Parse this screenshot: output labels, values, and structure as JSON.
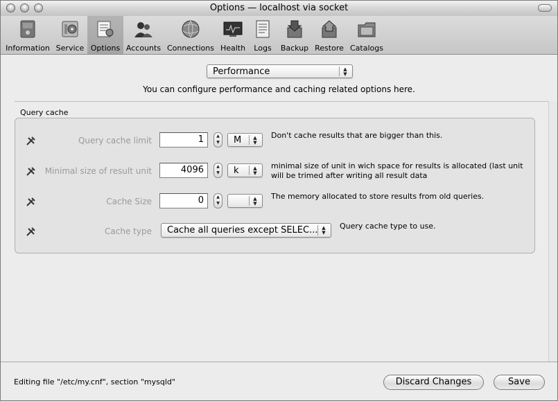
{
  "window": {
    "title": "Options — localhost via socket"
  },
  "toolbar": {
    "items": [
      {
        "label": "Information",
        "icon": "information-icon"
      },
      {
        "label": "Service",
        "icon": "service-icon"
      },
      {
        "label": "Options",
        "icon": "options-icon",
        "selected": true
      },
      {
        "label": "Accounts",
        "icon": "accounts-icon"
      },
      {
        "label": "Connections",
        "icon": "connections-icon"
      },
      {
        "label": "Health",
        "icon": "health-icon"
      },
      {
        "label": "Logs",
        "icon": "logs-icon"
      },
      {
        "label": "Backup",
        "icon": "backup-icon"
      },
      {
        "label": "Restore",
        "icon": "restore-icon"
      },
      {
        "label": "Catalogs",
        "icon": "catalogs-icon"
      }
    ]
  },
  "section_select": {
    "value": "Performance"
  },
  "section_description": "You can configure performance and caching related options here.",
  "group": {
    "title": "Query cache",
    "rows": [
      {
        "label": "Query cache limit",
        "value": "1",
        "unit": "M",
        "description": "Don't cache results that are bigger than this."
      },
      {
        "label": "Minimal size of result unit",
        "value": "4096",
        "unit": "k",
        "description": "minimal size of unit in wich space for results is allocated (last unit will be trimed after writing all result data"
      },
      {
        "label": "Cache Size",
        "value": "0",
        "unit": "",
        "description": "The memory allocated to store results from old queries."
      },
      {
        "label": "Cache type",
        "value": "Cache all queries except SELEC...",
        "description": "Query cache type to use."
      }
    ]
  },
  "status": {
    "text": "Editing file \"/etc/my.cnf\", section \"mysqld\""
  },
  "buttons": {
    "discard": "Discard Changes",
    "save": "Save"
  }
}
